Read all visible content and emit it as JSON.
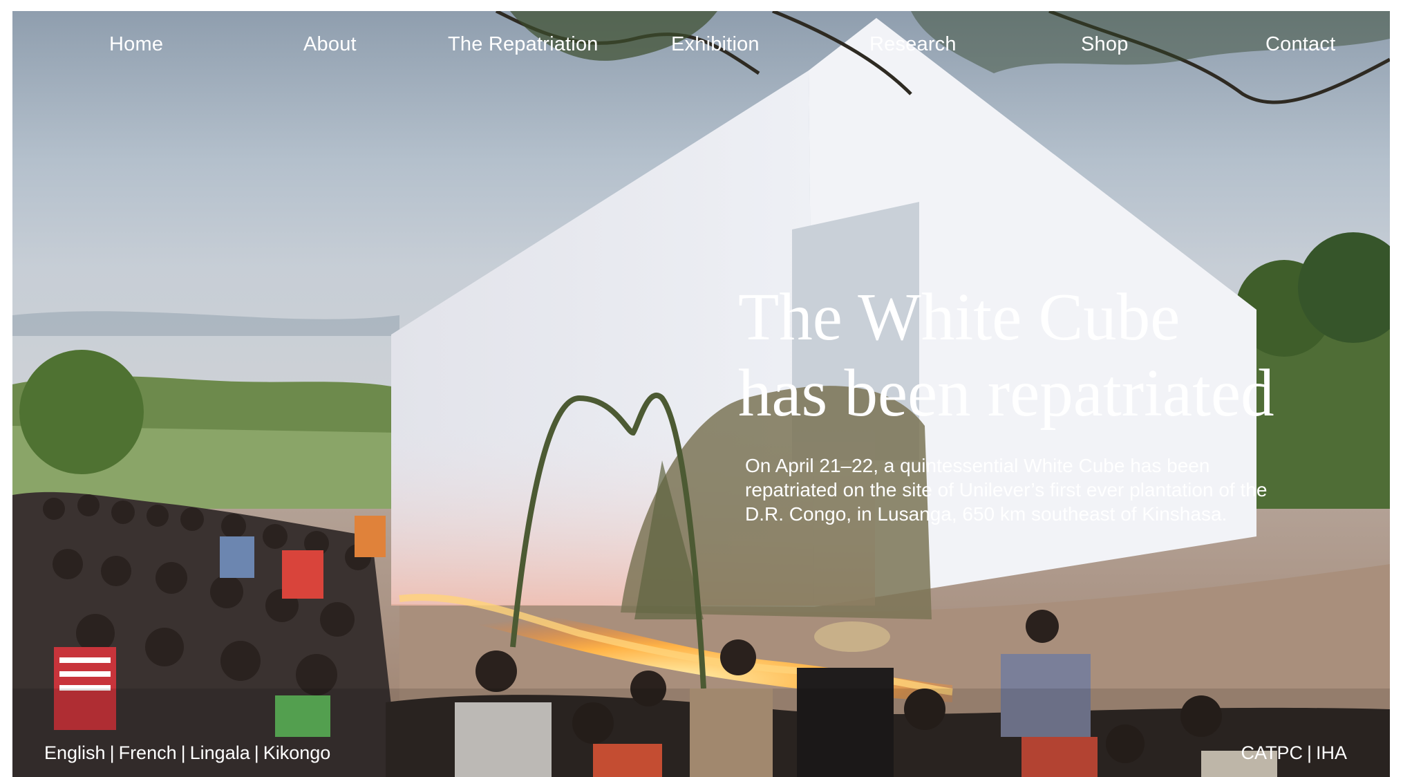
{
  "nav": {
    "items": [
      {
        "label": "Home"
      },
      {
        "label": "About"
      },
      {
        "label": "The Repatriation"
      },
      {
        "label": "Exhibition"
      },
      {
        "label": "Research"
      },
      {
        "label": "Shop"
      },
      {
        "label": "Contact"
      }
    ]
  },
  "hero": {
    "title_line1": "The White Cube",
    "title_line2": "has been repatriated",
    "description": "On April 21–22, a quintessential White Cube has been repatriated on the site of Unilever’s first ever plantation of the D.R. Congo, in Lusanga, 650 km southeast of Kinshasa."
  },
  "languages": {
    "items": [
      "English",
      "French",
      "Lingala",
      "Kikongo"
    ],
    "separator": "|"
  },
  "organizations": {
    "items": [
      "CATPC",
      "IHA"
    ],
    "separator": "|"
  },
  "colors": {
    "text": "#ffffff",
    "sky": "#aab8c6",
    "cube": "#e6e6ec",
    "fire": "#ff9a2a"
  }
}
